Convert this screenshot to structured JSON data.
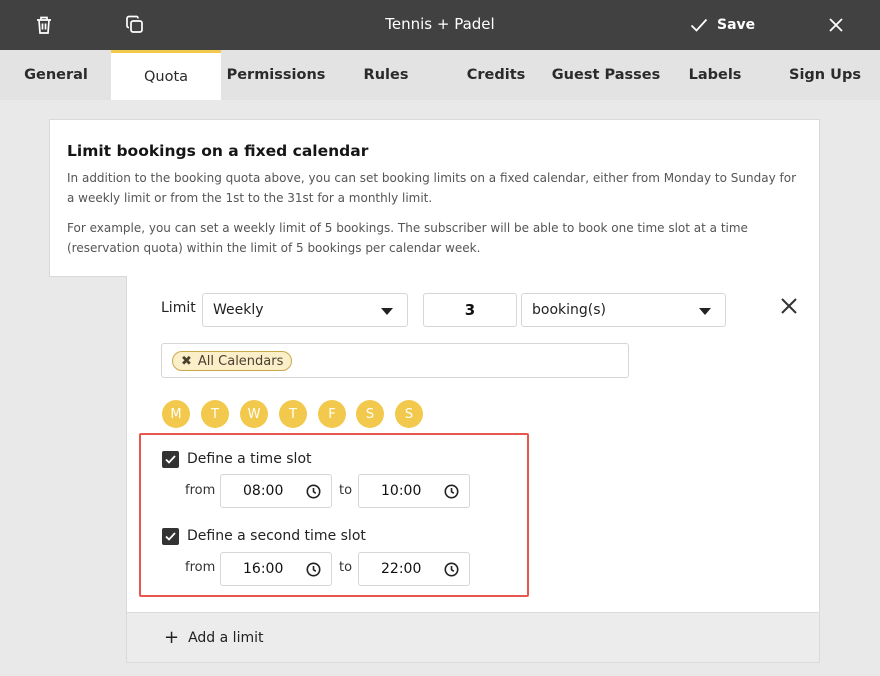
{
  "toolbar": {
    "title": "Tennis + Padel",
    "save_label": "Save"
  },
  "tabs": [
    {
      "label": "General"
    },
    {
      "label": "Quota",
      "active": true
    },
    {
      "label": "Permissions"
    },
    {
      "label": "Rules"
    },
    {
      "label": "Credits"
    },
    {
      "label": "Guest Passes"
    },
    {
      "label": "Labels"
    },
    {
      "label": "Sign Ups"
    }
  ],
  "info": {
    "heading": "Limit bookings on a fixed calendar",
    "paragraph1": "In addition to the booking quota above, you can set booking limits on a fixed calendar, either from Monday to Sunday for a weekly limit or from the 1st to the 31st for a monthly limit.",
    "paragraph2": "For example, you can set a weekly limit of 5 bookings. The subscriber will be able to book one time slot at a time (reservation quota) within the limit of 5 bookings per calendar week."
  },
  "limit": {
    "label": "Limit",
    "period": "Weekly",
    "quantity": "3",
    "unit": "booking(s)",
    "calendar_chip": "All Calendars",
    "days": [
      "M",
      "T",
      "W",
      "T",
      "F",
      "S",
      "S"
    ],
    "slot1": {
      "label": "Define a time slot",
      "checked": true,
      "from_label": "from",
      "from": "08:00",
      "to_label": "to",
      "to": "10:00"
    },
    "slot2": {
      "label": "Define a second time slot",
      "checked": true,
      "from_label": "from",
      "from": "16:00",
      "to_label": "to",
      "to": "22:00"
    }
  },
  "add_limit_label": "Add a limit",
  "colors": {
    "topbar": "#414141",
    "accent": "#f2c94c",
    "highlight": "#e8574e"
  }
}
